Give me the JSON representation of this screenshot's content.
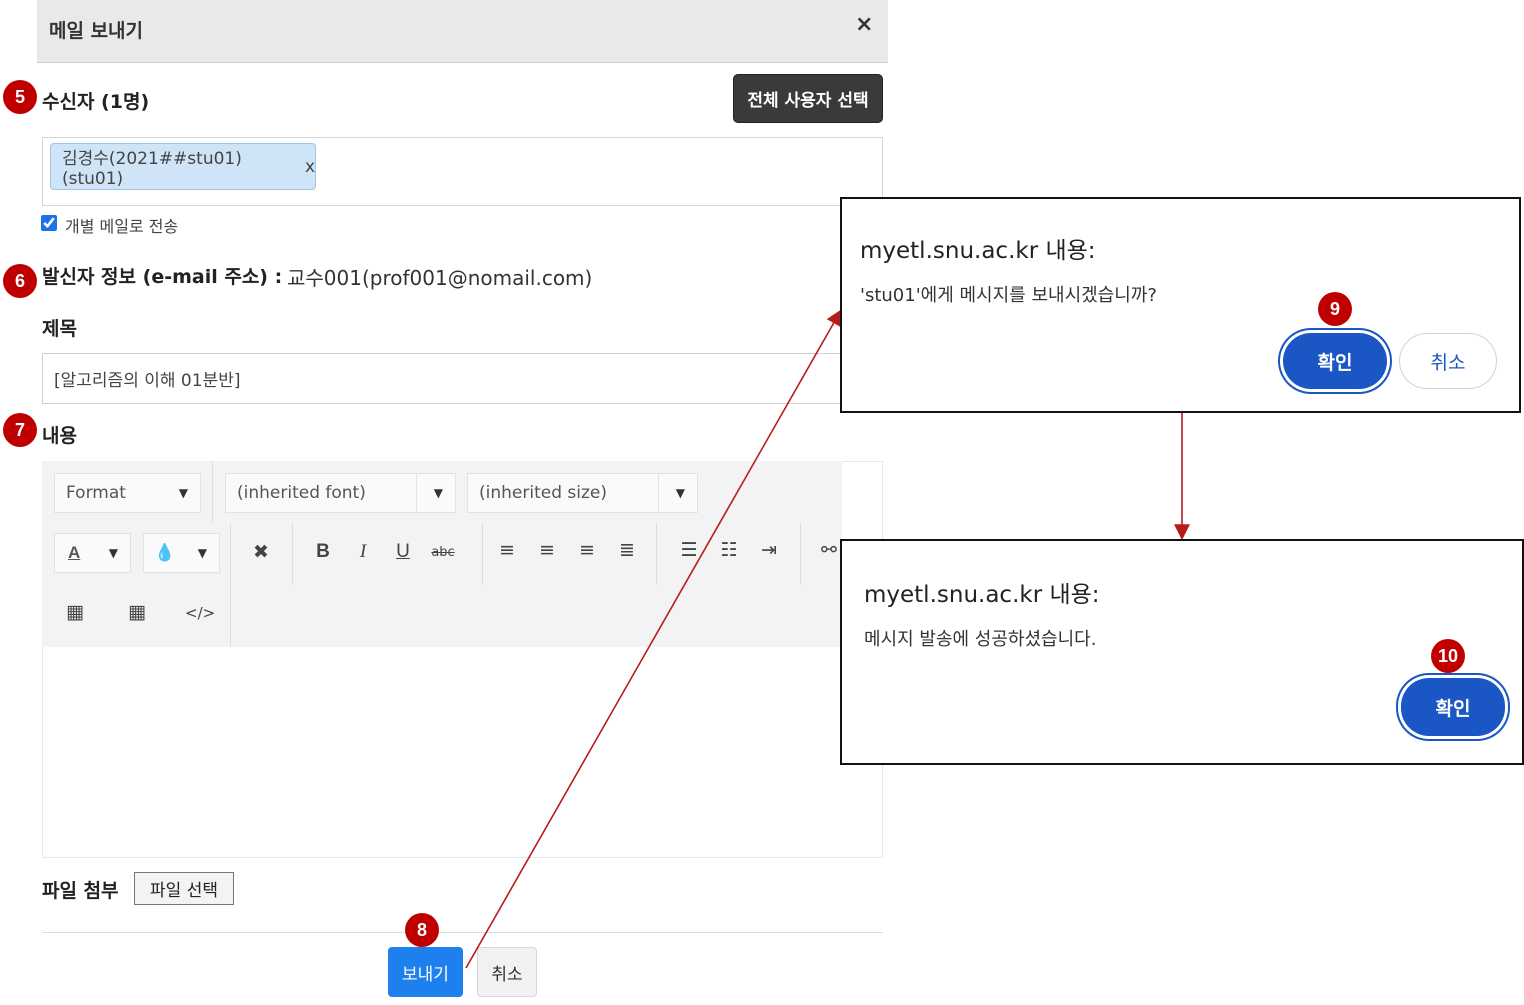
{
  "modal": {
    "title": "메일 보내기",
    "close_icon": "×"
  },
  "steps": {
    "s5": "5",
    "s6": "6",
    "s7": "7",
    "s8": "8",
    "s9": "9",
    "s10": "10"
  },
  "recipients": {
    "label": "수신자 (1명)",
    "select_all_label": "전체 사용자 선택",
    "chips": [
      {
        "text": "김경수(2021##stu01)(stu01)",
        "remove": "x"
      }
    ],
    "individual_label": "개별 메일로 전송",
    "individual_checked": true
  },
  "sender": {
    "label": "발신자 정보 (e-mail 주소) :",
    "value": "교수001(prof001@nomail.com)"
  },
  "subject": {
    "label": "제목",
    "value": "[알고리즘의 이해 01분반]"
  },
  "content": {
    "label": "내용"
  },
  "editor": {
    "format": "Format",
    "font": "(inherited font)",
    "size": "(inherited size)",
    "text_color_glyph": "A",
    "bold": "B",
    "italic": "I",
    "underline": "U",
    "strike": "abc",
    "code": "</>"
  },
  "attachment": {
    "label": "파일 첨부",
    "button": "파일 선택"
  },
  "footer": {
    "send": "보내기",
    "cancel": "취소"
  },
  "confirm_dialog": {
    "title": "myetl.snu.ac.kr 내용:",
    "message": "'stu01'에게 메시지를 보내시겠습니까?",
    "ok": "확인",
    "cancel": "취소"
  },
  "success_dialog": {
    "title": "myetl.snu.ac.kr 내용:",
    "message": "메시지 발송에 성공하셨습니다.",
    "ok": "확인"
  },
  "colors": {
    "badge": "#c00000",
    "arrow": "#b71c1c",
    "primary": "#1a56c4",
    "send": "#1e80ef"
  }
}
